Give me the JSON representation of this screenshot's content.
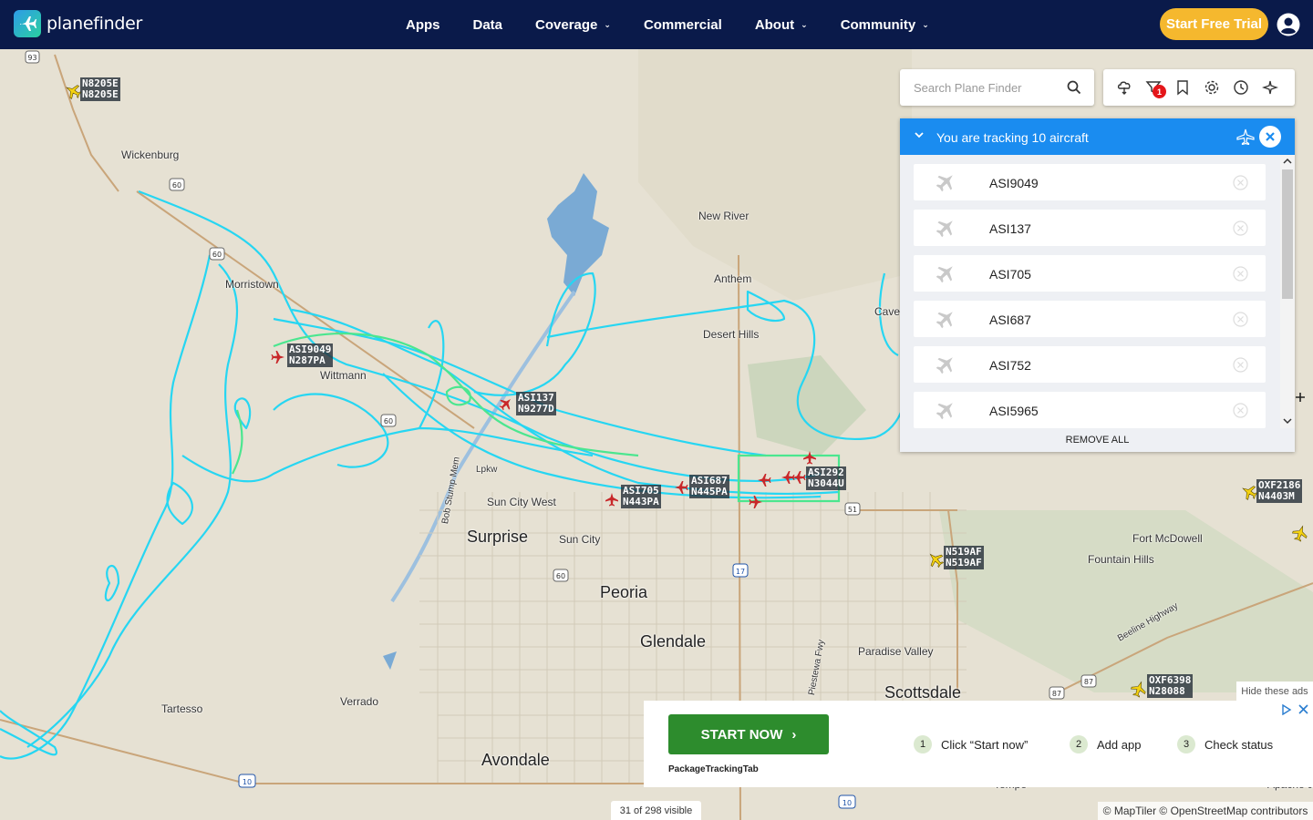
{
  "header": {
    "logo_text": "planefinder",
    "nav": [
      {
        "label": "Apps",
        "has_menu": false
      },
      {
        "label": "Data",
        "has_menu": false
      },
      {
        "label": "Coverage",
        "has_menu": true
      },
      {
        "label": "Commercial",
        "has_menu": false
      },
      {
        "label": "About",
        "has_menu": true
      },
      {
        "label": "Community",
        "has_menu": true
      }
    ],
    "trial_label": "Start Free Trial"
  },
  "search": {
    "placeholder": "Search Plane Finder"
  },
  "toolbar": {
    "filter_badge": "1"
  },
  "tracking": {
    "title": "You are tracking 10 aircraft",
    "items": [
      "ASI9049",
      "ASI137",
      "ASI705",
      "ASI687",
      "ASI752",
      "ASI5965"
    ],
    "remove_all": "REMOVE ALL"
  },
  "map_labels": {
    "places": [
      "Wickenburg",
      "New River",
      "Anthem",
      "Desert Hills",
      "Morristown",
      "Wittmann",
      "Surprise",
      "Sun City West",
      "Sun City",
      "Peoria",
      "Glendale",
      "Avondale",
      "Tartesso",
      "Verrado",
      "Fort McDowell",
      "Fountain Hills",
      "Paradise Valley",
      "Scottsdale",
      "Cave",
      "Apache Junc",
      "Tempe"
    ],
    "roads": [
      "Bob Stump Mem",
      "Lpkw",
      "Beeline Highway",
      "Piestewa Fwy"
    ],
    "highway_shields": [
      "93",
      "60",
      "60",
      "60",
      "60",
      "17",
      "51",
      "10",
      "10",
      "87",
      "87"
    ]
  },
  "aircraft": [
    {
      "callsign": "N8205E",
      "reg": "N8205E"
    },
    {
      "callsign": "ASI9049",
      "reg": "N287PA"
    },
    {
      "callsign": "ASI137",
      "reg": "N9277D"
    },
    {
      "callsign": "ASI705",
      "reg": "N443PA"
    },
    {
      "callsign": "ASI687",
      "reg": "N445PA"
    },
    {
      "callsign": "ASI292",
      "reg": "N3044U"
    },
    {
      "callsign": "OXF2186",
      "reg": "N4403M"
    },
    {
      "callsign": "N519AF",
      "reg": "N519AF"
    },
    {
      "callsign": "OXF6398",
      "reg": "N28088"
    }
  ],
  "ad": {
    "hide_label": "Hide these ads",
    "button": "START NOW",
    "brand": "PackageTrackingTab",
    "steps": [
      {
        "num": "1",
        "text": "Click “Start now”"
      },
      {
        "num": "2",
        "text": "Add app"
      },
      {
        "num": "3",
        "text": "Check status"
      }
    ]
  },
  "footer": {
    "visible": "31 of 298 visible",
    "attribution": "© MapTiler © OpenStreetMap contributors"
  },
  "colors": {
    "header_bg": "#0a1a4a",
    "accent": "#1a8cf0",
    "trial": "#f5b82e",
    "track": "#26d6f2",
    "track_alt": "#4be68f"
  }
}
